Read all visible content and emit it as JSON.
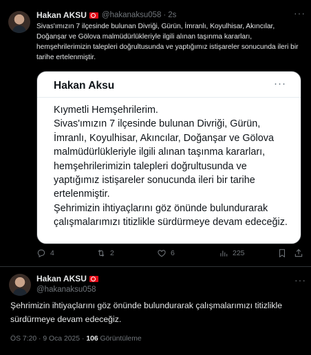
{
  "tweet1": {
    "name": "Hakan AKSU",
    "handle": "@hakanaksu058",
    "separator": "·",
    "time": "2s",
    "text": "Sivas'ımızın 7 ilçesinde bulunan Divriği, Gürün, İmranlı, Koyulhisar, Akıncılar, Doğanşar ve Gölova malmüdürlükleriyle ilgili alınan taşınma kararları, hemşehrilerimizin talepleri doğrultusunda ve  yaptığımız istişareler sonucunda ileri bir tarihe ertelenmiştir.",
    "card": {
      "name": "Hakan Aksu",
      "greeting": "Kıymetli Hemşehrilerim.",
      "paragraph1": "Sivas'ımızın 7 ilçesinde bulunan Divriği, Gürün, İmranlı, Koyulhisar, Akıncılar, Doğanşar ve Gölova malmüdürlükleriyle ilgili alınan taşınma kararları, hemşehrilerimizin talepleri doğrultusunda ve  yaptığımız  istişareler sonucunda ileri bir tarihe ertelenmiştir.",
      "paragraph2": "Şehrimizin ihtiyaçlarını göz önünde bulundurarak çalışmalarımızı titizlikle sürdürmeye devam edeceğiz."
    },
    "actions": {
      "replies": "4",
      "reposts": "2",
      "likes": "6",
      "views": "225"
    }
  },
  "tweet2": {
    "name": "Hakan AKSU",
    "handle": "@hakanaksu058",
    "text": "Şehrimizin ihtiyaçlarını göz önünde bulundurarak çalışmalarımızı titizlikle sürdürmeye devam edeceğiz.",
    "time": "ÖS 7:20 · 9 Oca 2025 · ",
    "views_count": "106",
    "views_label": " Görüntüleme"
  },
  "colors": {
    "background": "#000000",
    "text": "#e7e9ea",
    "muted": "#71767b",
    "flag": "#e30a17"
  }
}
